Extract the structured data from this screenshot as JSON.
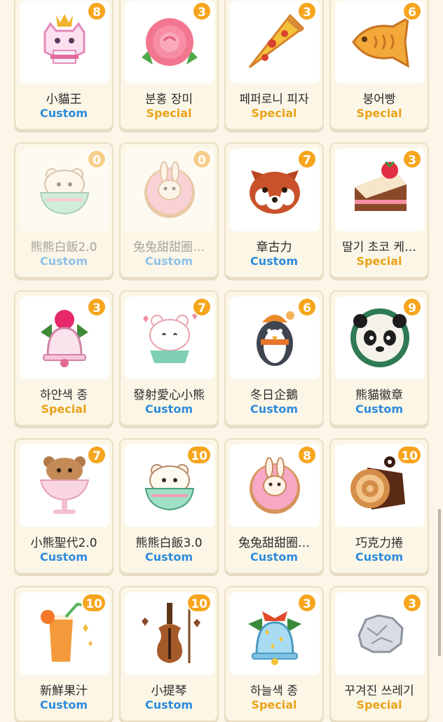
{
  "stickers": [
    {
      "name": "小貓王",
      "type": "Custom",
      "count": "8",
      "icon": "cat-king-icon",
      "locked": false
    },
    {
      "name": "분홍 장미",
      "type": "Special",
      "count": "3",
      "icon": "pink-rose-icon",
      "locked": false
    },
    {
      "name": "페퍼로니 피자",
      "type": "Special",
      "count": "3",
      "icon": "pizza-icon",
      "locked": false
    },
    {
      "name": "붕어빵",
      "type": "Special",
      "count": "6",
      "icon": "fish-bread-icon",
      "locked": false
    },
    {
      "name": "熊熊白飯2.0",
      "type": "Custom",
      "count": "0",
      "icon": "bear-rice-bowl-icon",
      "locked": true
    },
    {
      "name": "兔兔甜甜圈…",
      "type": "Custom",
      "count": "0",
      "icon": "bunny-donut-icon",
      "locked": true
    },
    {
      "name": "章古力",
      "type": "Custom",
      "count": "7",
      "icon": "red-panda-icon",
      "locked": false
    },
    {
      "name": "딸기 초코 케…",
      "type": "Special",
      "count": "3",
      "icon": "strawberry-cake-icon",
      "locked": false
    },
    {
      "name": "하얀색 종",
      "type": "Special",
      "count": "3",
      "icon": "white-bell-icon",
      "locked": false
    },
    {
      "name": "發射愛心小熊",
      "type": "Custom",
      "count": "7",
      "icon": "heart-bear-icon",
      "locked": false
    },
    {
      "name": "冬日企鵝",
      "type": "Custom",
      "count": "6",
      "icon": "winter-penguin-icon",
      "locked": false
    },
    {
      "name": "熊貓徽章",
      "type": "Custom",
      "count": "9",
      "icon": "panda-badge-icon",
      "locked": false
    },
    {
      "name": "小熊聖代2.0",
      "type": "Custom",
      "count": "7",
      "icon": "bear-sundae-icon",
      "locked": false
    },
    {
      "name": "熊熊白飯3.0",
      "type": "Custom",
      "count": "10",
      "icon": "bear-rice-bowl-icon",
      "locked": false
    },
    {
      "name": "兔兔甜甜圈…",
      "type": "Custom",
      "count": "8",
      "icon": "bunny-donut-icon",
      "locked": false
    },
    {
      "name": "巧克力捲",
      "type": "Custom",
      "count": "10",
      "icon": "chocolate-roll-icon",
      "locked": false
    },
    {
      "name": "新鮮果汁",
      "type": "Custom",
      "count": "10",
      "icon": "orange-juice-icon",
      "locked": false
    },
    {
      "name": "小提琴",
      "type": "Custom",
      "count": "10",
      "icon": "violin-icon",
      "locked": false
    },
    {
      "name": "하늘색 종",
      "type": "Special",
      "count": "3",
      "icon": "sky-bell-icon",
      "locked": false
    },
    {
      "name": "꾸겨진 쓰레기",
      "type": "Special",
      "count": "3",
      "icon": "crumpled-trash-icon",
      "locked": false
    }
  ]
}
